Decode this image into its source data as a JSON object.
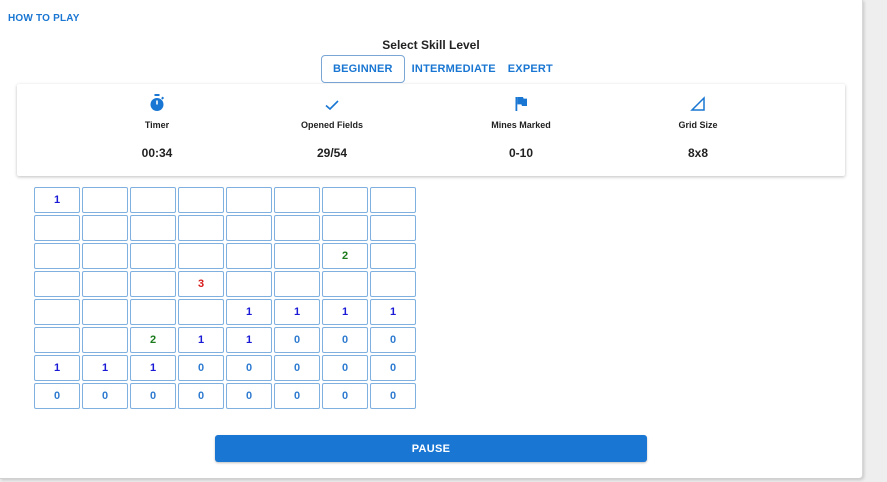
{
  "header": {
    "how_to_play": "HOW TO PLAY"
  },
  "skill": {
    "title": "Select Skill Level",
    "levels": [
      "BEGINNER",
      "INTERMEDIATE",
      "EXPERT"
    ],
    "selected": "BEGINNER"
  },
  "stats": {
    "timer": {
      "label": "Timer",
      "value": "00:34",
      "icon": "stopwatch-icon"
    },
    "opened": {
      "label": "Opened Fields",
      "value": "29/54",
      "icon": "check-icon"
    },
    "mines": {
      "label": "Mines Marked",
      "value": "0-10",
      "icon": "flag-icon"
    },
    "grid": {
      "label": "Grid Size",
      "value": "8x8",
      "icon": "triangle-ruler-icon"
    }
  },
  "board": {
    "rows": [
      [
        "1",
        "",
        "",
        "",
        "",
        "",
        "",
        ""
      ],
      [
        "",
        "",
        "",
        "",
        "",
        "",
        "",
        ""
      ],
      [
        "",
        "",
        "",
        "",
        "",
        "",
        "2",
        ""
      ],
      [
        "",
        "",
        "",
        "3",
        "",
        "",
        "",
        ""
      ],
      [
        "",
        "",
        "",
        "",
        "1",
        "1",
        "1",
        "1"
      ],
      [
        "",
        "",
        "2",
        "1",
        "1",
        "0",
        "0",
        "0"
      ],
      [
        "1",
        "1",
        "1",
        "0",
        "0",
        "0",
        "0",
        "0"
      ],
      [
        "0",
        "0",
        "0",
        "0",
        "0",
        "0",
        "0",
        "0"
      ]
    ]
  },
  "pause_label": "PAUSE",
  "colors": {
    "accent": "#1976d2",
    "number_1": "#1a1ad6",
    "number_2": "#1b7a1b",
    "number_3": "#d81b1b",
    "number_0": "#2e7bd0"
  }
}
